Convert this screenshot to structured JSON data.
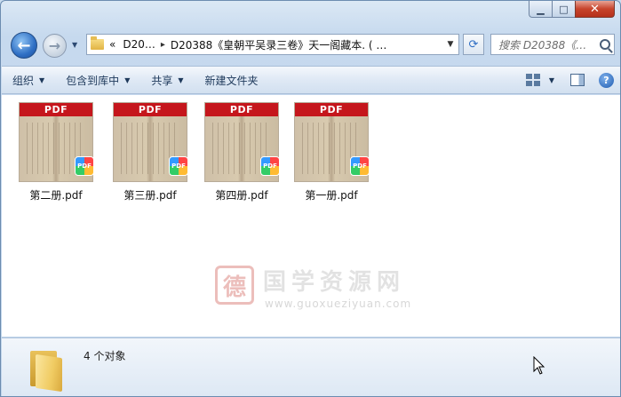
{
  "window": {
    "caption": {
      "minimize": "▁",
      "maximize": "□",
      "close": "✕"
    }
  },
  "navbar": {
    "back_glyph": "←",
    "forward_glyph": "→",
    "history_glyph": "▼",
    "address": {
      "prefix": "«",
      "crumbs": [
        "D20…",
        "D20388《皇朝平吴录三卷》天一阁藏本. ( …"
      ],
      "separator": "▸",
      "dropdown_glyph": "▼"
    },
    "refresh_glyph": "⟳",
    "search_placeholder": "搜索 D20388《…"
  },
  "toolbar": {
    "organize": "组织",
    "include_in_library": "包含到库中",
    "share": "共享",
    "new_folder": "新建文件夹",
    "caret": "▼",
    "help": "?"
  },
  "files": [
    {
      "name": "第二册.pdf",
      "thumb_label": "PDF",
      "badge": "PDF"
    },
    {
      "name": "第三册.pdf",
      "thumb_label": "PDF",
      "badge": "PDF"
    },
    {
      "name": "第四册.pdf",
      "thumb_label": "PDF",
      "badge": "PDF"
    },
    {
      "name": "第一册.pdf",
      "thumb_label": "PDF",
      "badge": "PDF"
    }
  ],
  "watermark": {
    "seal": "德",
    "text": "国学资源网",
    "url": "www.guoxueziyuan.com"
  },
  "status": {
    "count_text": "4 个对象"
  },
  "colors": {
    "pdf_band": "#c5161c",
    "toolbar_text": "#1e395b",
    "accent_blue": "#2f6fc4"
  }
}
